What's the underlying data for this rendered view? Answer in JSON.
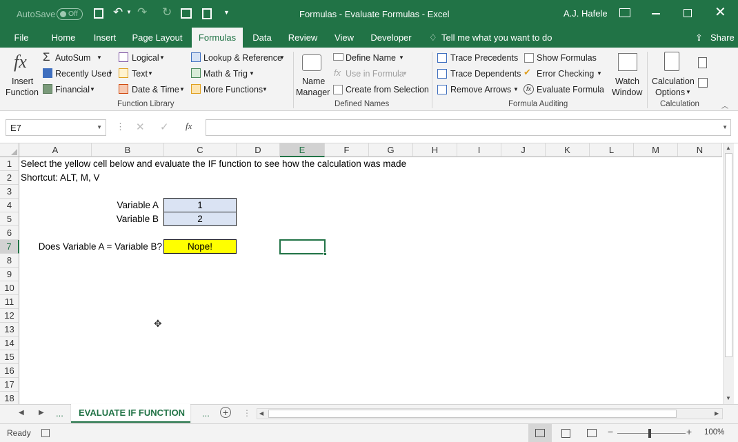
{
  "titlebar": {
    "autosave_label": "AutoSave",
    "autosave_state": "Off",
    "doc_title": "Formulas - Evaluate Formulas  -  Excel",
    "user": "A.J. Hafele"
  },
  "tabs": [
    "File",
    "Home",
    "Insert",
    "Page Layout",
    "Formulas",
    "Data",
    "Review",
    "View",
    "Developer"
  ],
  "tell_me": "Tell me what you want to do",
  "share": "Share",
  "ribbon": {
    "insert_function_1": "Insert",
    "insert_function_2": "Function",
    "autosum": "AutoSum",
    "recently_used": "Recently Used",
    "financial": "Financial",
    "logical": "Logical",
    "text": "Text",
    "date_time": "Date & Time",
    "lookup_reference": "Lookup & Reference",
    "math_trig": "Math & Trig",
    "more_functions": "More Functions",
    "function_library": "Function Library",
    "name_manager_1": "Name",
    "name_manager_2": "Manager",
    "define_name": "Define Name",
    "use_in_formula": "Use in Formula",
    "create_from_selection": "Create from Selection",
    "defined_names": "Defined Names",
    "trace_precedents": "Trace Precedents",
    "trace_dependents": "Trace Dependents",
    "remove_arrows": "Remove Arrows",
    "show_formulas": "Show Formulas",
    "error_checking": "Error Checking",
    "evaluate_formula": "Evaluate Formula",
    "formula_auditing": "Formula Auditing",
    "watch_window_1": "Watch",
    "watch_window_2": "Window",
    "calc_options_1": "Calculation",
    "calc_options_2": "Options",
    "calculation": "Calculation"
  },
  "formula_bar": {
    "name_box": "E7",
    "fx": "fx",
    "formula": ""
  },
  "columns": [
    "A",
    "B",
    "C",
    "D",
    "E",
    "F",
    "G",
    "H",
    "I",
    "J",
    "K",
    "L",
    "M",
    "N"
  ],
  "rows": [
    "1",
    "2",
    "3",
    "4",
    "5",
    "6",
    "7",
    "8",
    "9",
    "10",
    "11",
    "12",
    "13",
    "14",
    "15",
    "16",
    "17",
    "18"
  ],
  "cells": {
    "A1": "Select the yellow cell below and evaluate the IF function to see how the calculation was made",
    "A2": "Shortcut: ALT, M, V",
    "B4": "Variable A",
    "C4": "1",
    "B5": "Variable B",
    "C5": "2",
    "A7": "Does Variable A = Variable B?",
    "C7": "Nope!"
  },
  "colors": {
    "excel_green": "#217346",
    "input_fill": "#dae3f3",
    "result_fill": "#ffff00"
  },
  "sheet_tabs": {
    "ellipsis_left": "...",
    "active": "EVALUATE IF FUNCTION",
    "ellipsis_right": "..."
  },
  "status": {
    "ready": "Ready",
    "zoom": "100%"
  }
}
